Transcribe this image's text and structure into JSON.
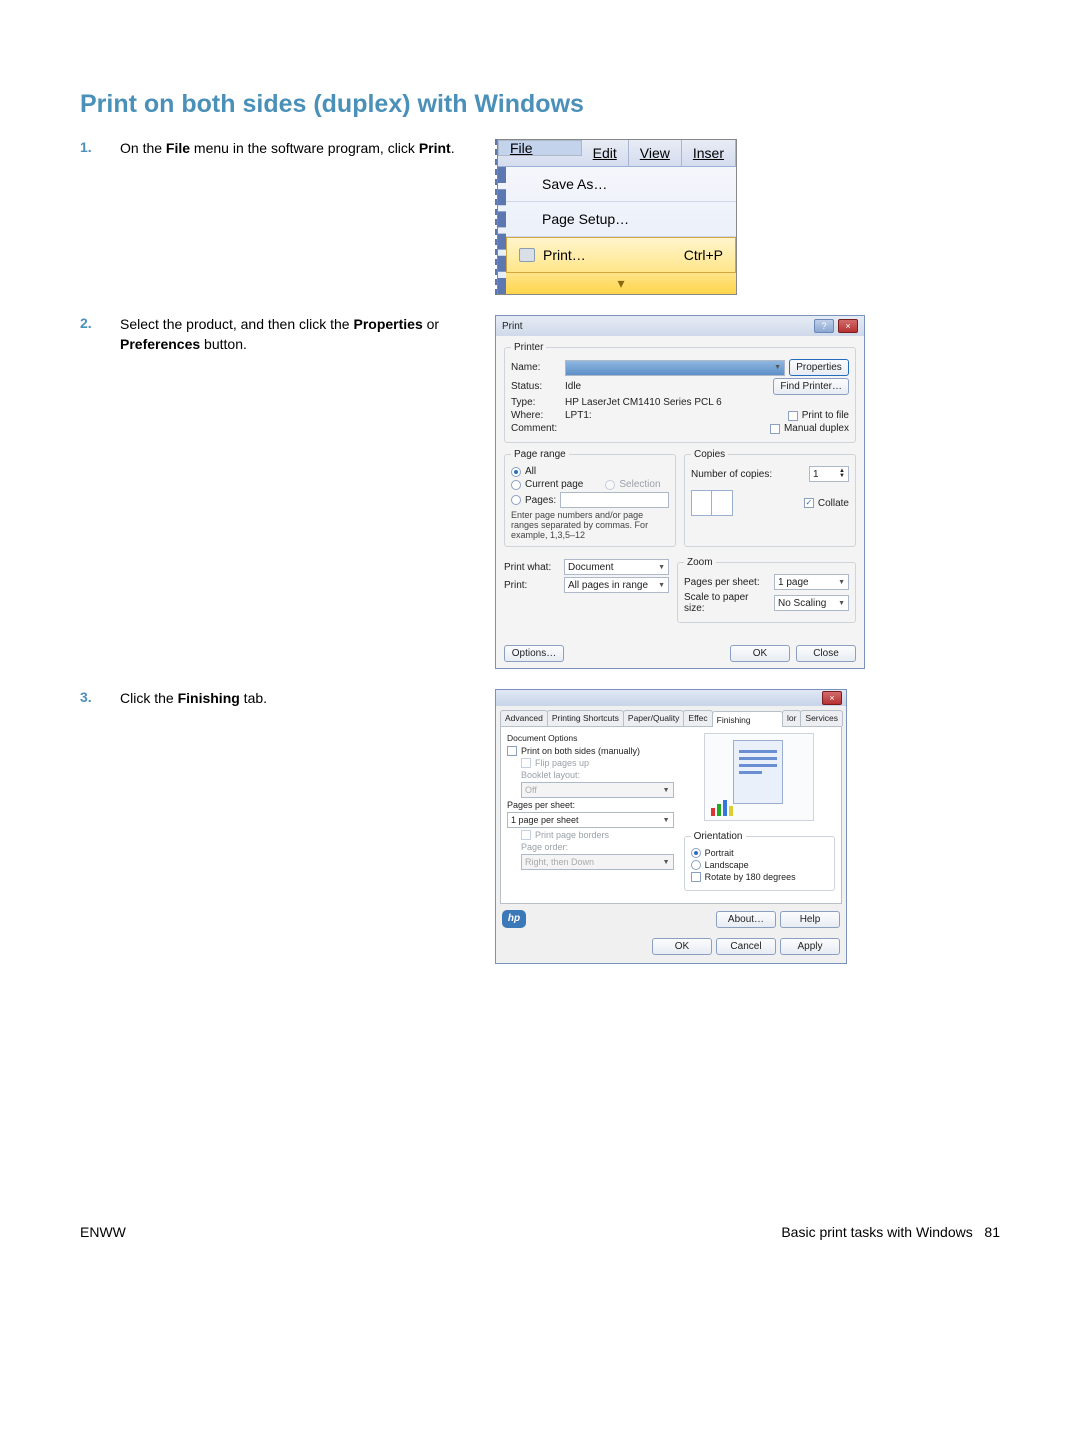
{
  "title": "Print on both sides (duplex) with Windows",
  "steps": [
    {
      "num": "1.",
      "text_pre": "On the ",
      "bold1": "File",
      "text_mid": " menu in the software program, click ",
      "bold2": "Print",
      "text_post": "."
    },
    {
      "num": "2.",
      "text_pre": "Select the product, and then click the ",
      "bold1": "Properties",
      "text_mid": " or ",
      "bold2": "Preferences",
      "text_post": " button."
    },
    {
      "num": "3.",
      "text_pre": "Click the ",
      "bold1": "Finishing",
      "text_mid": " tab.",
      "bold2": "",
      "text_post": ""
    }
  ],
  "menu": {
    "tabs": {
      "file": "File",
      "edit": "Edit",
      "view": "View",
      "inser": "Inser"
    },
    "saveas": "Save As…",
    "pagesetup": "Page Setup…",
    "print": "Print…",
    "print_shortcut": "Ctrl+P"
  },
  "print_dialog": {
    "title": "Print",
    "printer_legend": "Printer",
    "name_label": "Name:",
    "status_label": "Status:",
    "status_value": "Idle",
    "type_label": "Type:",
    "type_value": "HP LaserJet CM1410 Series PCL 6",
    "where_label": "Where:",
    "where_value": "LPT1:",
    "comment_label": "Comment:",
    "properties_btn": "Properties",
    "find_printer_btn": "Find Printer…",
    "print_to_file": "Print to file",
    "manual_duplex": "Manual duplex",
    "page_range_legend": "Page range",
    "all": "All",
    "current_page": "Current page",
    "selection": "Selection",
    "pages": "Pages:",
    "pages_hint": "Enter page numbers and/or page ranges separated by commas. For example, 1,3,5–12",
    "copies_legend": "Copies",
    "num_copies": "Number of copies:",
    "num_copies_val": "1",
    "collate": "Collate",
    "print_what": "Print what:",
    "print_what_val": "Document",
    "print_label": "Print:",
    "print_val": "All pages in range",
    "zoom_legend": "Zoom",
    "pps": "Pages per sheet:",
    "pps_val": "1 page",
    "stps": "Scale to paper size:",
    "stps_val": "No Scaling",
    "options_btn": "Options…",
    "ok_btn": "OK",
    "close_btn": "Close"
  },
  "prop_dialog": {
    "tabs": [
      "Advanced",
      "Printing Shortcuts",
      "Paper/Quality",
      "Effec",
      "Finishing",
      "lor",
      "Services"
    ],
    "doc_opts": "Document Options",
    "print_both": "Print on both sides (manually)",
    "flip_pages": "Flip pages up",
    "booklet": "Booklet layout:",
    "booklet_val": "Off",
    "pps_label": "Pages per sheet:",
    "pps_val": "1 page per sheet",
    "print_borders": "Print page borders",
    "page_order": "Page order:",
    "page_order_val": "Right, then Down",
    "orientation": "Orientation",
    "portrait": "Portrait",
    "landscape": "Landscape",
    "rotate": "Rotate by 180 degrees",
    "about_btn": "About…",
    "help_btn": "Help",
    "ok_btn": "OK",
    "cancel_btn": "Cancel",
    "apply_btn": "Apply"
  },
  "footer": {
    "left": "ENWW",
    "right_text": "Basic print tasks with Windows",
    "page_num": "81"
  }
}
